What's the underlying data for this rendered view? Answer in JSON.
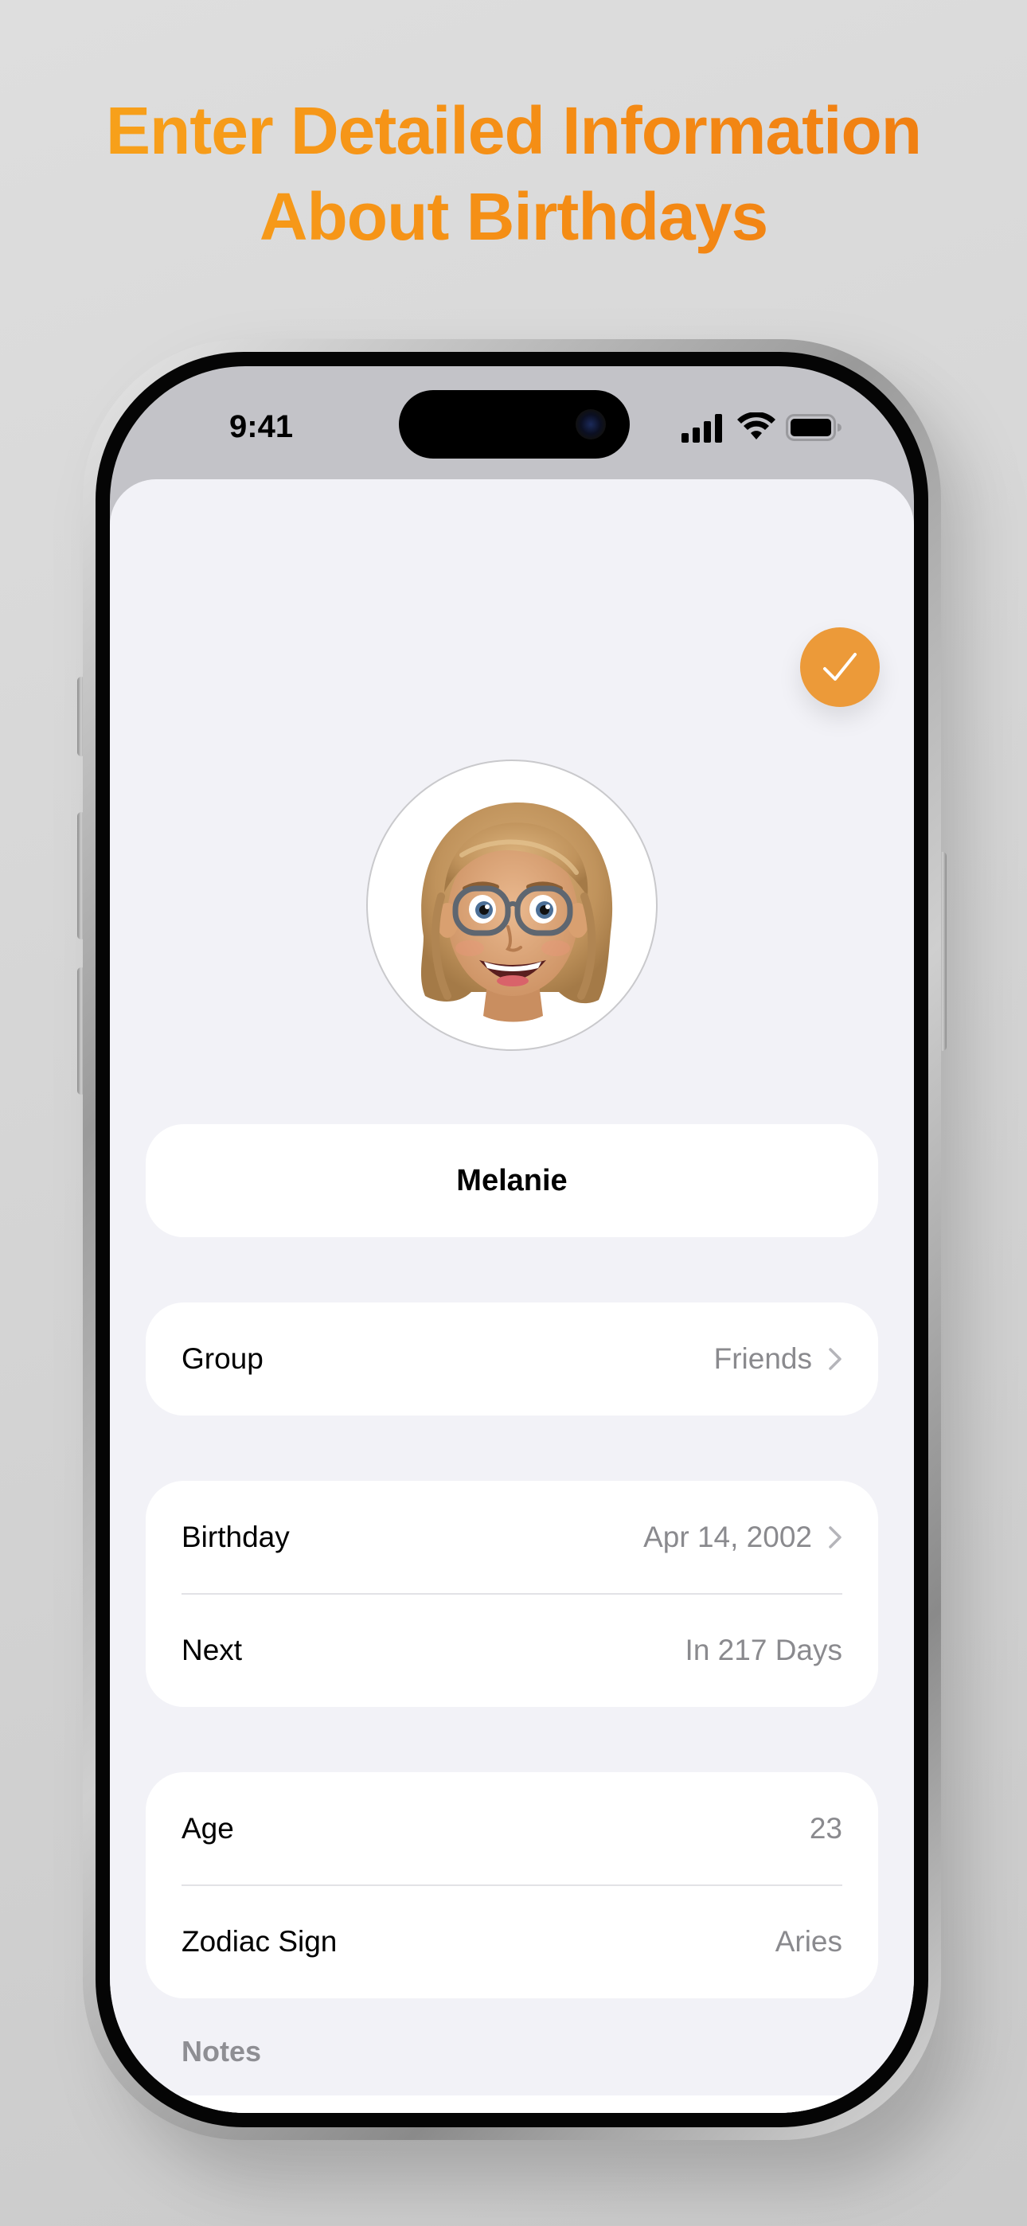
{
  "headline": {
    "line1": "Enter Detailed Information",
    "line2": "About Birthdays"
  },
  "status_bar": {
    "time": "9:41"
  },
  "accent_color": "#ec9a39",
  "done_button": {
    "icon": "checkmark-icon"
  },
  "avatar": {
    "icon": "memoji-avatar"
  },
  "name_field": {
    "value": "Melanie"
  },
  "group_row": {
    "label": "Group",
    "value": "Friends"
  },
  "birthday_section": {
    "birthday_label": "Birthday",
    "birthday_value": "Apr 14, 2002",
    "next_label": "Next",
    "next_value": "In 217 Days"
  },
  "age_section": {
    "age_label": "Age",
    "age_value": "23",
    "zodiac_label": "Zodiac Sign",
    "zodiac_value": "Aries"
  },
  "notes": {
    "label": "Notes",
    "value": ""
  }
}
